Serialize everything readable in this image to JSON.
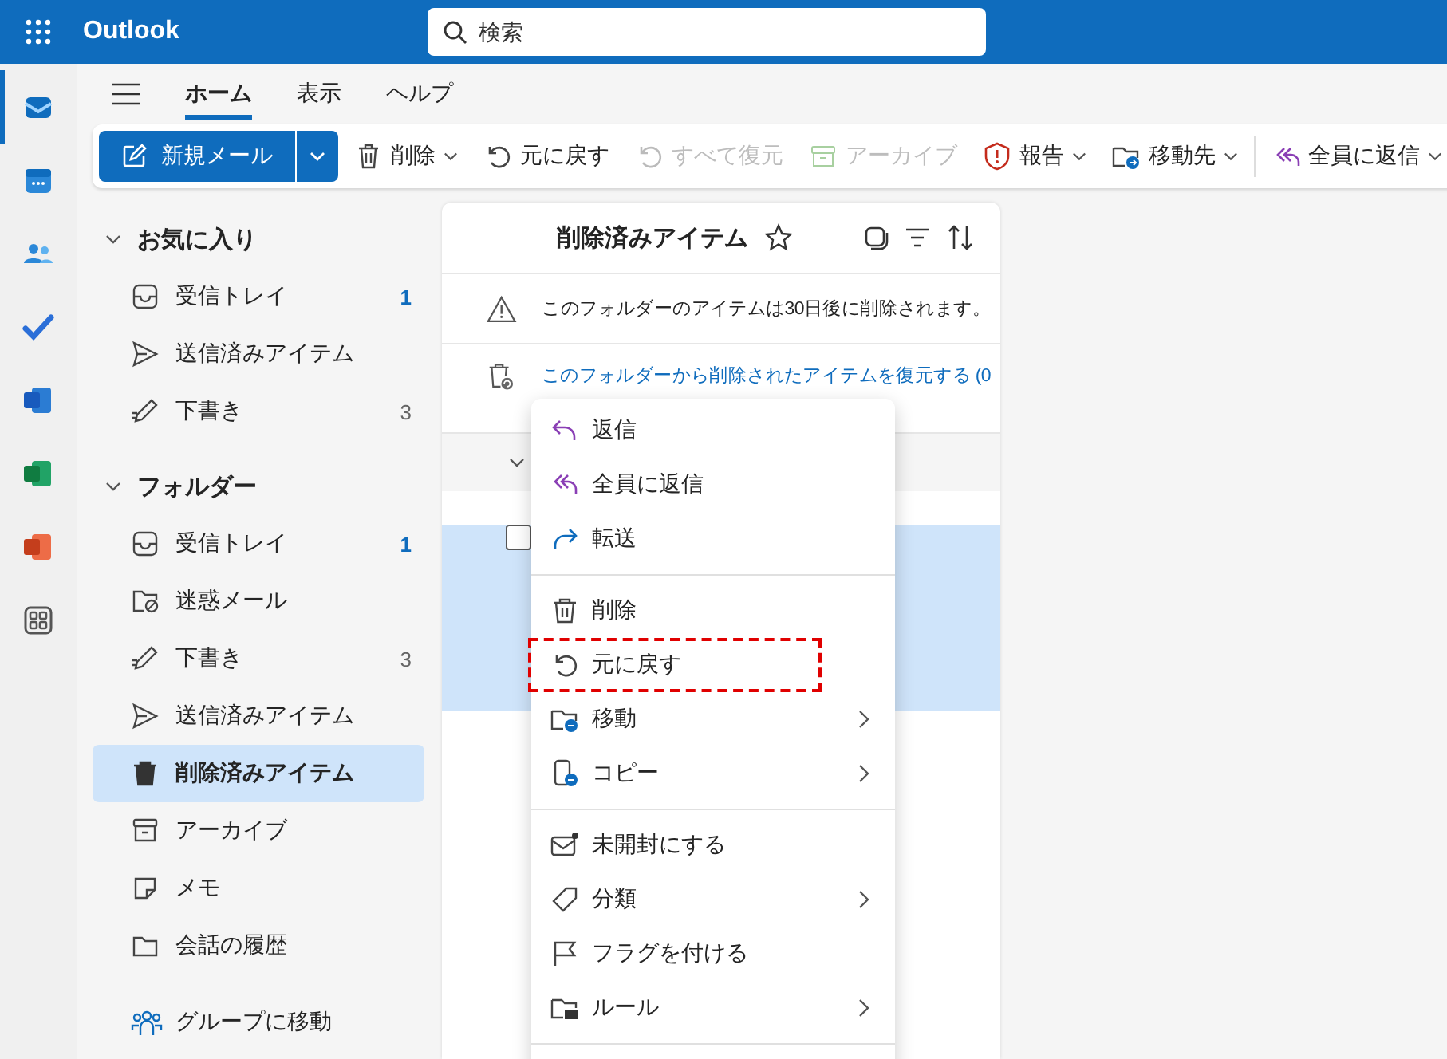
{
  "app": {
    "name": "Outlook"
  },
  "search": {
    "placeholder": "検索"
  },
  "rail": [
    {
      "selected": true
    },
    {
      "selected": false
    },
    {
      "selected": false
    },
    {
      "selected": false
    },
    {
      "selected": false
    },
    {
      "selected": false
    },
    {
      "selected": false
    },
    {
      "selected": false
    }
  ],
  "tabs": [
    {
      "label": "ホーム",
      "selected": true
    },
    {
      "label": "表示",
      "selected": false
    },
    {
      "label": "ヘルプ",
      "selected": false
    }
  ],
  "toolbar": [
    {
      "label": "新規メール",
      "kind": "primary",
      "dropdown": true
    },
    {
      "label": "削除",
      "kind": "button",
      "disabled": false,
      "dropdown": true
    },
    {
      "label": "元に戻す",
      "kind": "button",
      "disabled": false,
      "dropdown": false
    },
    {
      "label": "すべて復元",
      "kind": "button",
      "disabled": true,
      "dropdown": false
    },
    {
      "label": "アーカイブ",
      "kind": "button",
      "disabled": true,
      "dropdown": false
    },
    {
      "label": "報告",
      "kind": "button",
      "disabled": false,
      "dropdown": true
    },
    {
      "label": "移動先",
      "kind": "button",
      "disabled": false,
      "dropdown": true
    },
    {
      "kind": "divider"
    },
    {
      "label": "全員に返信",
      "kind": "button",
      "disabled": false,
      "dropdown": true
    }
  ],
  "sidebar": {
    "sections": [
      {
        "title": "お気に入り",
        "expanded": true,
        "items": [
          {
            "label": "受信トレイ",
            "count": "1",
            "unread": true,
            "selected": false
          },
          {
            "label": "送信済みアイテム",
            "selected": false
          },
          {
            "label": "下書き",
            "count": "3",
            "unread": false,
            "selected": false
          }
        ]
      },
      {
        "title": "フォルダー",
        "expanded": true,
        "items": [
          {
            "label": "受信トレイ",
            "count": "1",
            "unread": true,
            "selected": false
          },
          {
            "label": "迷惑メール",
            "selected": false
          },
          {
            "label": "下書き",
            "count": "3",
            "unread": false,
            "selected": false
          },
          {
            "label": "送信済みアイテム",
            "selected": false
          },
          {
            "label": "削除済みアイテム",
            "selected": true
          },
          {
            "label": "アーカイブ",
            "selected": false
          },
          {
            "label": "メモ",
            "selected": false
          },
          {
            "label": "会話の履歴",
            "selected": false
          }
        ]
      }
    ],
    "footer_link": "グループに移動"
  },
  "message_list": {
    "title": "削除済みアイテム",
    "notice": "このフォルダーのアイテムは30日後に削除されます。",
    "restore_link": "このフォルダーから削除されたアイテムを復元する (0",
    "group_expanded": true,
    "message": {
      "checked": false,
      "selected": true
    }
  },
  "context_menu": {
    "groups": [
      [
        {
          "label": "返信",
          "submenu": false,
          "highlighted": false
        },
        {
          "label": "全員に返信",
          "submenu": false,
          "highlighted": false
        },
        {
          "label": "転送",
          "submenu": false,
          "highlighted": false
        }
      ],
      [
        {
          "label": "削除",
          "submenu": false,
          "highlighted": false
        },
        {
          "label": "元に戻す",
          "submenu": false,
          "highlighted": true
        },
        {
          "label": "移動",
          "submenu": true,
          "highlighted": false
        },
        {
          "label": "コピー",
          "submenu": true,
          "highlighted": false
        }
      ],
      [
        {
          "label": "未開封にする",
          "submenu": false,
          "highlighted": false
        },
        {
          "label": "分類",
          "submenu": true,
          "highlighted": false
        },
        {
          "label": "フラグを付ける",
          "submenu": false,
          "highlighted": false
        },
        {
          "label": "ルール",
          "submenu": true,
          "highlighted": false
        }
      ]
    ]
  }
}
